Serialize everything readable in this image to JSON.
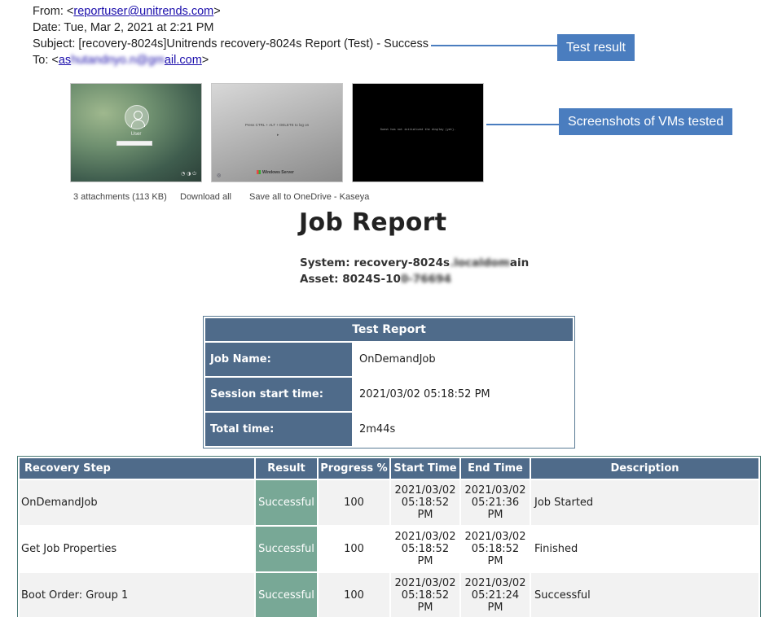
{
  "email": {
    "from_label": "From: <",
    "from_address": "reportuser@unitrends.com",
    "from_close": ">",
    "date": "Date: Tue, Mar 2, 2021 at 2:21 PM",
    "subject": "Subject: [recovery-8024s]Unitrends recovery-8024s Report (Test) - Success",
    "to_label": "To: <",
    "to_address_visible_start": "as",
    "to_address_blurred": "hutandnyo.n@gm",
    "to_address_visible_end": "ail.com",
    "to_close": ">"
  },
  "callouts": {
    "test_result": "Test result",
    "screenshots": "Screenshots of VMs tested"
  },
  "thumbnails": {
    "user_label": "User",
    "ctrl_alt_del": "Press CTRL + ALT + DELETE to log on",
    "windows_server": "Windows Server",
    "boot_message": "Guest has not initialized the display (yet)."
  },
  "attachments": {
    "count": "3 attachments (113 KB)",
    "download_all": "Download all",
    "save_onedrive": "Save all to OneDrive - Kaseya"
  },
  "report": {
    "title": "Job Report",
    "system_label": "System: recovery-8024s",
    "system_blurred": ".localdom",
    "system_end": "ain",
    "asset_label": "Asset: 8024S-10",
    "asset_blurred": "0-76694"
  },
  "test_report": {
    "heading": "Test Report",
    "rows": [
      {
        "label": "Job Name:",
        "value": "OnDemandJob"
      },
      {
        "label": "Session start time:",
        "value": "2021/03/02 05:18:52 PM"
      },
      {
        "label": "Total time:",
        "value": "2m44s"
      }
    ]
  },
  "steps": {
    "headers": [
      "Recovery Step",
      "Result",
      "Progress %",
      "Start Time",
      "End Time",
      "Description"
    ],
    "rows": [
      {
        "step": "OnDemandJob",
        "result": "Successful",
        "progress": "100",
        "start_date": "2021/03/02",
        "start_time": "05:18:52",
        "start_ampm": "PM",
        "end_date": "2021/03/02",
        "end_time": "05:21:36",
        "end_ampm": "PM",
        "description": "Job Started"
      },
      {
        "step": "Get Job Properties",
        "result": "Successful",
        "progress": "100",
        "start_date": "2021/03/02",
        "start_time": "05:18:52",
        "start_ampm": "PM",
        "end_date": "2021/03/02",
        "end_time": "05:18:52",
        "end_ampm": "PM",
        "description": "Finished"
      },
      {
        "step": "Boot Order: Group 1",
        "result": "Successful",
        "progress": "100",
        "start_date": "2021/03/02",
        "start_time": "05:18:52",
        "start_ampm": "PM",
        "end_date": "2021/03/02",
        "end_time": "05:21:24",
        "end_ampm": "PM",
        "description": "Successful"
      }
    ]
  },
  "colors": {
    "header_blue": "#4f6b8a",
    "success_green": "#78a896",
    "callout_blue": "#4a7dbf",
    "link": "#1a0dab"
  }
}
